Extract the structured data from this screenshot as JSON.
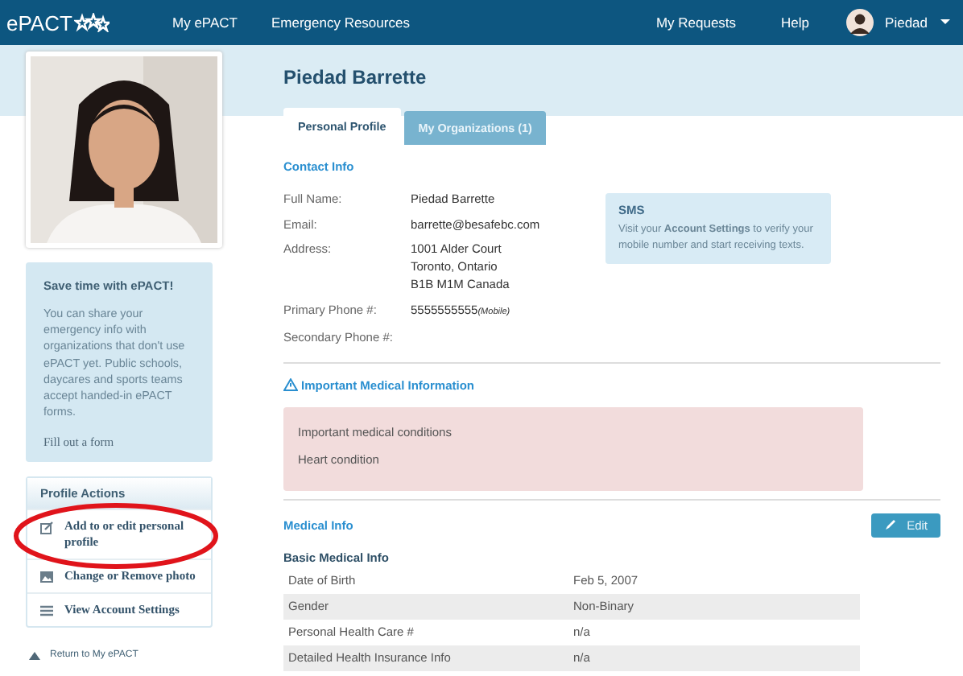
{
  "nav": {
    "brand": "ePACT",
    "links": [
      {
        "label": "My ePACT"
      },
      {
        "label": "Emergency Resources"
      }
    ],
    "right_links": [
      {
        "label": "My Requests"
      },
      {
        "label": "Help"
      }
    ],
    "user": "Piedad"
  },
  "sidebar": {
    "promo": {
      "title": "Save time with ePACT!",
      "text": "You can share your emergency info with organizations that don't use ePACT yet. Public schools, daycares and sports teams accept handed-in ePACT forms.",
      "link": "Fill out a form"
    },
    "actions": {
      "title": "Profile Actions",
      "items": [
        {
          "label": "Add to or edit personal profile",
          "kind": "edit"
        },
        {
          "label": "Change or Remove photo"
        },
        {
          "label": "View Account Settings",
          "kind": "settings"
        }
      ]
    },
    "return_link": "Return to My ePACT"
  },
  "main": {
    "name": "Piedad Barrette",
    "tabs": [
      {
        "label": "Personal Profile",
        "selected": true
      },
      {
        "label": "My Organizations (1)",
        "selected": false
      }
    ],
    "contact": {
      "heading": "Contact Info",
      "fields": [
        {
          "label": "Full Name:",
          "lines": [
            "Piedad Barrette"
          ]
        },
        {
          "label": "Email:",
          "lines": [
            "barrette@besafebc.com"
          ]
        },
        {
          "label": "Address:",
          "lines": [
            "1001 Alder Court",
            "Toronto, Ontario",
            "B1B M1M Canada"
          ]
        },
        {
          "label": "Primary Phone #:",
          "lines": [
            "5555555555"
          ],
          "note": "(Mobile)"
        },
        {
          "label": "Secondary Phone #:"
        }
      ]
    },
    "sms": {
      "title": "SMS",
      "text": "Visit your **Account Settings** to verify your mobile number and start receiving texts."
    },
    "medical_alert": {
      "heading": "Important Medical Information",
      "items": [
        "Important medical conditions",
        "Heart condition"
      ]
    },
    "medical": {
      "heading": "Medical Info",
      "edit": "Edit",
      "subheading": "Basic Medical Info",
      "rows": [
        {
          "label": "Date of Birth",
          "value": "Feb 5, 2007"
        },
        {
          "label": "Gender",
          "value": "Non-Binary"
        },
        {
          "label": "Personal Health Care #",
          "value": "n/a"
        },
        {
          "label": "Detailed Health Insurance Info",
          "value": "n/a"
        }
      ]
    }
  }
}
